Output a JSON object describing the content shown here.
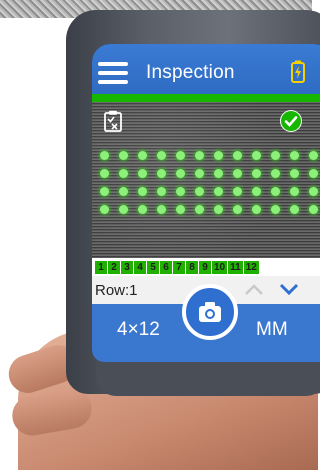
{
  "header": {
    "title": "Inspection",
    "menu_icon": "hamburger-menu-icon",
    "battery_icon": "battery-charging-icon",
    "accent_color": "#3a78cf"
  },
  "view": {
    "clipboard_icon": "clipboard-check-icon",
    "status_icon": "check-circle-icon",
    "status_color": "#17b600"
  },
  "columns": [
    "1",
    "2",
    "3",
    "4",
    "5",
    "6",
    "7",
    "8",
    "9",
    "10",
    "11",
    "12"
  ],
  "row": {
    "label": "Row:1",
    "up_icon": "chevron-up-icon",
    "down_icon": "chevron-down-icon"
  },
  "footer": {
    "grid_size": "4×12",
    "camera_icon": "camera-icon",
    "units": "MM"
  }
}
